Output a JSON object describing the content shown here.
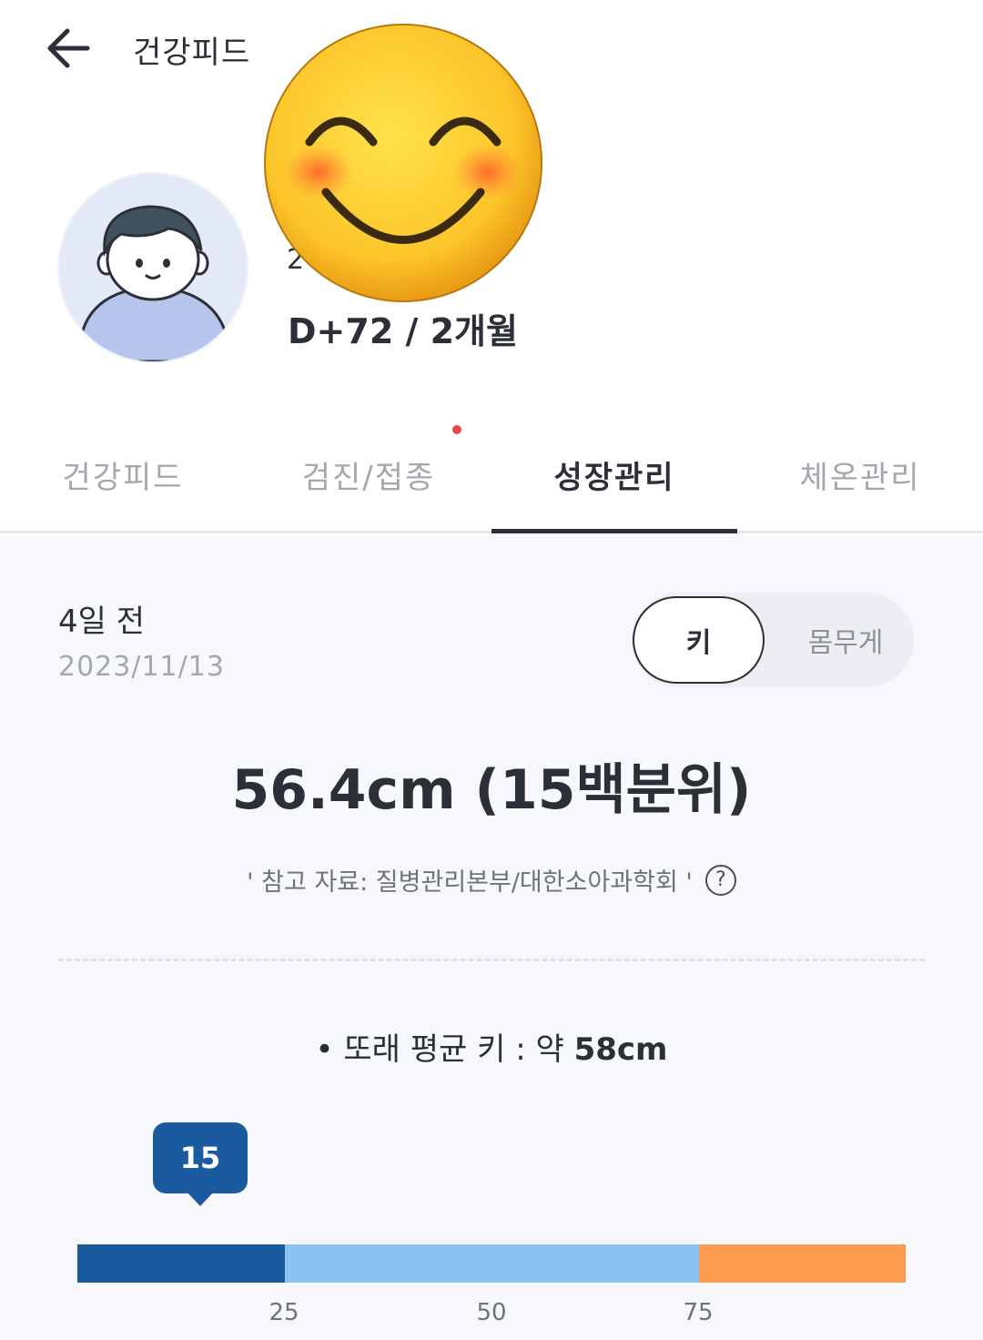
{
  "header": {
    "title": "건강피드"
  },
  "profile": {
    "sub_text": "2",
    "dday": "D+72 / 2개월"
  },
  "tabs": [
    {
      "label": "건강피드",
      "active": false
    },
    {
      "label": "검진/접종",
      "active": false,
      "has_badge": true
    },
    {
      "label": "성장관리",
      "active": true
    },
    {
      "label": "체온관리",
      "active": false
    }
  ],
  "record": {
    "relative_date": "4일 전",
    "date": "2023/11/13",
    "toggle": {
      "options": [
        "키",
        "몸무게"
      ],
      "selected": "키"
    },
    "measurement": "56.4cm (15백분위)",
    "reference": "' 참고 자료: 질병관리본부/대한소아과학회 '",
    "peer_label": "• 또래 평균 키 : 약 ",
    "peer_value": "58cm"
  },
  "percentile": {
    "value": 15,
    "value_label": "15",
    "ticks": [
      "25",
      "50",
      "75"
    ],
    "segments": [
      {
        "from": 0,
        "to": 25,
        "color": "#1a5a9e"
      },
      {
        "from": 25,
        "to": 75,
        "color": "#8ac3f0"
      },
      {
        "from": 75,
        "to": 100,
        "color": "#fd9a4e"
      }
    ]
  }
}
